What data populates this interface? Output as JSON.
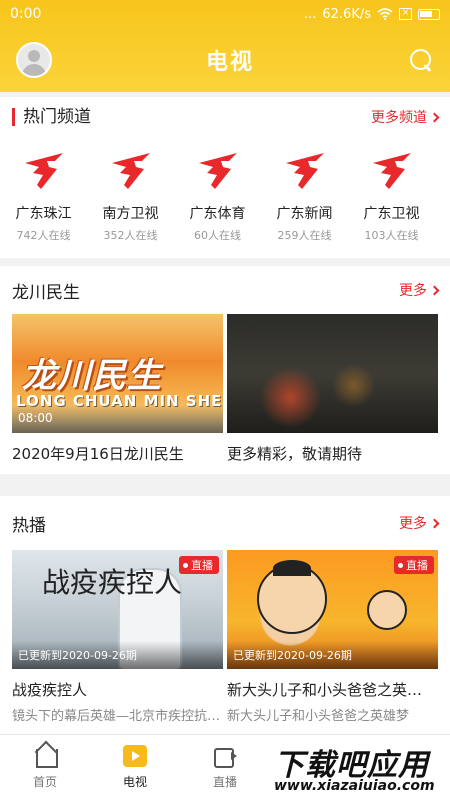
{
  "status": {
    "time": "0:00",
    "dots": "...",
    "speed": "62.6K/s"
  },
  "header": {
    "title": "电视"
  },
  "hot_channels": {
    "title": "热门频道",
    "more": "更多频道",
    "items": [
      {
        "name": "广东珠江",
        "count": "742人在线"
      },
      {
        "name": "南方卫视",
        "count": "352人在线"
      },
      {
        "name": "广东体育",
        "count": "60人在线"
      },
      {
        "name": "广东新闻",
        "count": "259人在线"
      },
      {
        "name": "广东卫视",
        "count": "103人在线"
      }
    ],
    "logo_color": "#e8292b"
  },
  "longchuan": {
    "title": "龙川民生",
    "more": "更多",
    "cards": [
      {
        "title": "2020年9月16日龙川民生",
        "duration": "08:00",
        "thumb_text": "龙川民生",
        "thumb_sub": "LONG CHUAN MIN SHENG"
      },
      {
        "title": "更多精彩，敬请期待"
      }
    ]
  },
  "hot": {
    "title": "热播",
    "more": "更多",
    "cards": [
      {
        "title": "战疫疾控人",
        "subtitle": "镜头下的幕后英雄—北京市疾控抗…",
        "badge": "直播",
        "updated": "已更新到2020-09-26期",
        "thumb_text": "战疫疾控人"
      },
      {
        "title": "新大头儿子和小头爸爸之英…",
        "subtitle": "新大头儿子和小头爸爸之英雄梦",
        "badge": "直播",
        "updated": "已更新到2020-09-26期"
      }
    ]
  },
  "tabbar": {
    "items": [
      {
        "label": "首页",
        "icon": "home-icon"
      },
      {
        "label": "电视",
        "icon": "tv-icon"
      },
      {
        "label": "直播",
        "icon": "live-icon"
      }
    ]
  },
  "watermark": {
    "text": "下载吧应用",
    "url": "www.xiazaiuiao.com"
  },
  "colors": {
    "accent": "#e8292b",
    "brand": "#f7c51b"
  }
}
